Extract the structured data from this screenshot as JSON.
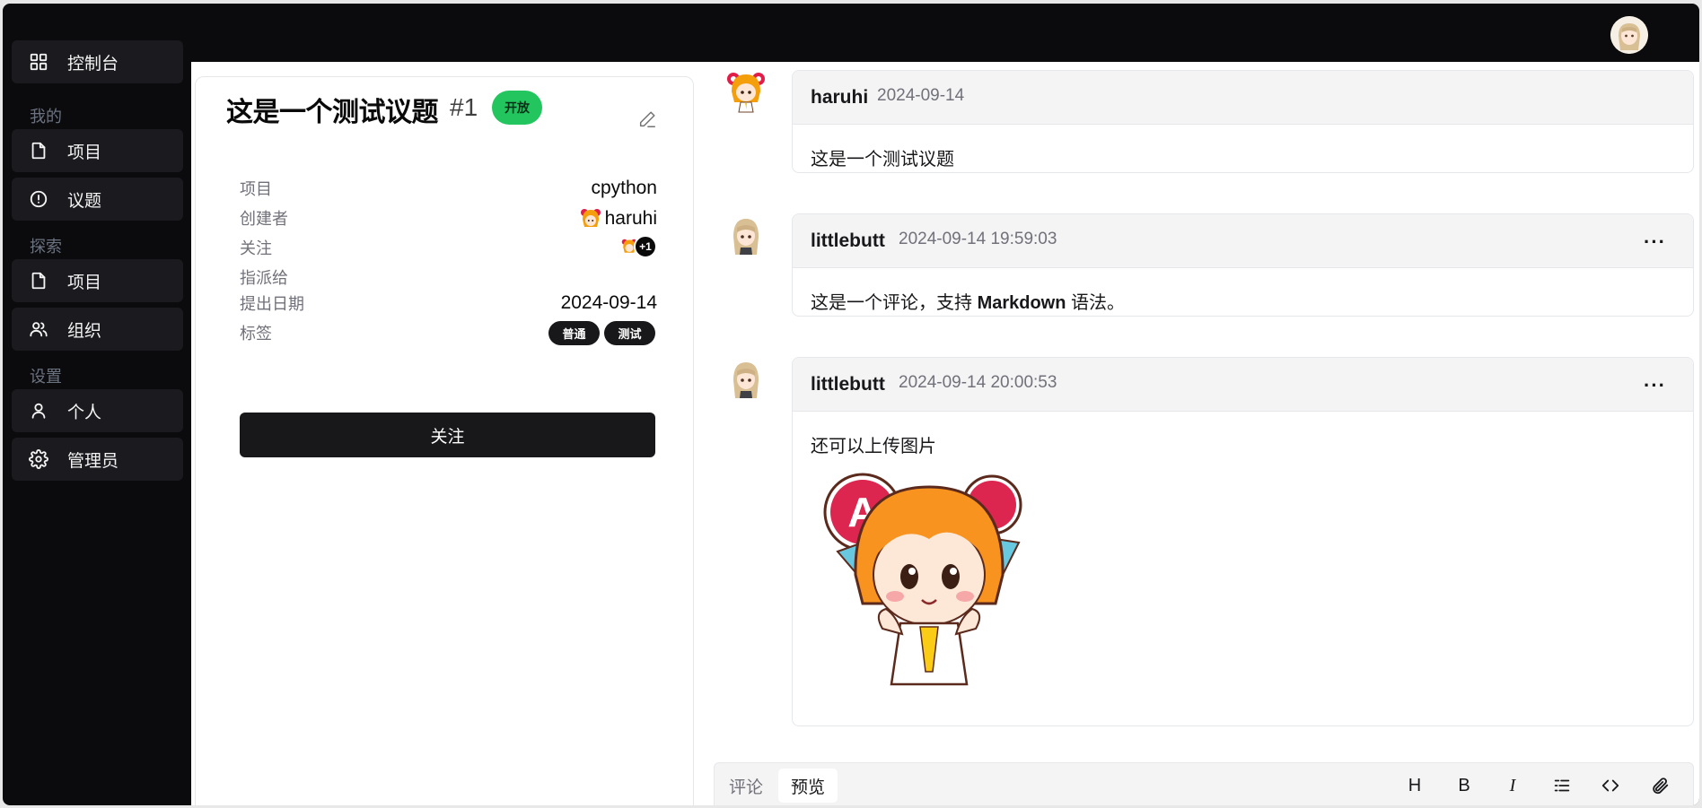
{
  "sidebar": {
    "dashboard": "控制台",
    "sections": {
      "mine": "我的",
      "explore": "探索",
      "settings": "设置"
    },
    "mine_items": [
      "项目",
      "议题"
    ],
    "explore_items": [
      "项目",
      "组织"
    ],
    "settings_items": [
      "个人",
      "管理员"
    ]
  },
  "issue": {
    "title": "这是一个测试议题",
    "number": "#1",
    "status": "开放",
    "meta": {
      "project_label": "项目",
      "project_value": "cpython",
      "creator_label": "创建者",
      "creator_value": "haruhi",
      "watchers_label": "关注",
      "watchers_more": "+1",
      "assignee_label": "指派给",
      "date_label": "提出日期",
      "date_value": "2024-09-14",
      "tags_label": "标签",
      "tags": [
        "普通",
        "测试"
      ]
    },
    "follow_button": "关注"
  },
  "comments": [
    {
      "author": "haruhi",
      "time": "2024-09-14",
      "body": "这是一个测试议题"
    },
    {
      "author": "littlebutt",
      "time": "2024-09-14 19:59:03",
      "body_pre": "这是一个评论，支持 ",
      "body_bold": "Markdown",
      "body_post": " 语法。"
    },
    {
      "author": "littlebutt",
      "time": "2024-09-14 20:00:53",
      "body": "还可以上传图片"
    }
  ],
  "comment_more": "···",
  "editor": {
    "tabs": [
      "评论",
      "预览"
    ],
    "tools": [
      "H",
      "B",
      "I"
    ]
  },
  "colors": {
    "sidebar_bg": "#0b0b0d",
    "accent": "#18181b",
    "status_open": "#22c55e"
  }
}
